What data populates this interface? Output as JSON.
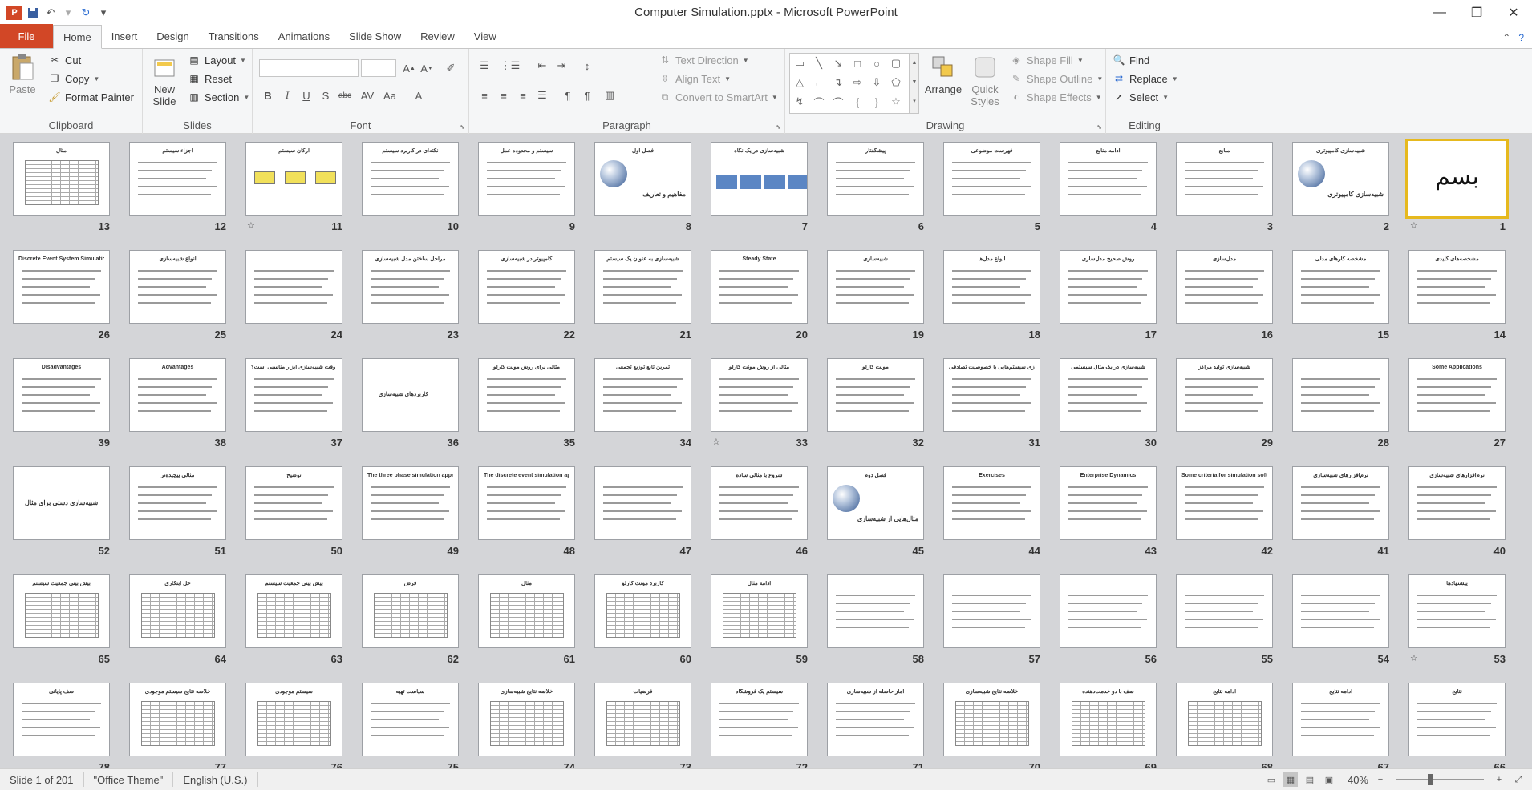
{
  "window": {
    "title": "Computer Simulation.pptx  -  Microsoft PowerPoint",
    "controls": [
      "minimize",
      "restore",
      "close"
    ]
  },
  "tabs": [
    "File",
    "Home",
    "Insert",
    "Design",
    "Transitions",
    "Animations",
    "Slide Show",
    "Review",
    "View"
  ],
  "active_tab": "Home",
  "ribbon": {
    "clipboard": {
      "label": "Clipboard",
      "paste": "Paste",
      "cut": "Cut",
      "copy": "Copy",
      "format_painter": "Format Painter"
    },
    "slides": {
      "label": "Slides",
      "new_slide_1": "New",
      "new_slide_2": "Slide",
      "layout": "Layout",
      "reset": "Reset",
      "section": "Section"
    },
    "font": {
      "label": "Font",
      "family": "",
      "size": ""
    },
    "paragraph": {
      "label": "Paragraph",
      "text_direction": "Text Direction",
      "align_text": "Align Text",
      "smartart": "Convert to SmartArt"
    },
    "drawing": {
      "label": "Drawing",
      "arrange": "Arrange",
      "quick_1": "Quick",
      "quick_2": "Styles",
      "shape_fill": "Shape Fill",
      "shape_outline": "Shape Outline",
      "shape_effects": "Shape Effects"
    },
    "editing": {
      "label": "Editing",
      "find": "Find",
      "replace": "Replace",
      "select": "Select"
    }
  },
  "slides": [
    {
      "n": "1",
      "t": ""
    },
    {
      "n": "2",
      "t": "شبیه‌سازی کامپیوتری"
    },
    {
      "n": "3",
      "t": "منابع"
    },
    {
      "n": "4",
      "t": "ادامه منابع"
    },
    {
      "n": "5",
      "t": "فهرست موضوعی"
    },
    {
      "n": "6",
      "t": "پیشگفتار"
    },
    {
      "n": "7",
      "t": "شبیه‌سازی در یک نگاه"
    },
    {
      "n": "8",
      "t": "فصل اول"
    },
    {
      "n": "9",
      "t": "سیستم و محدوده عمل"
    },
    {
      "n": "10",
      "t": "نکته‌ای در کاربرد سیستم"
    },
    {
      "n": "11",
      "t": "ارکان سیستم"
    },
    {
      "n": "12",
      "t": "اجزاء سیستم"
    },
    {
      "n": "13",
      "t": "مثال"
    },
    {
      "n": "14",
      "t": "مشخصه‌های کلیدی"
    },
    {
      "n": "15",
      "t": "مشخصه کارهای مدلی"
    },
    {
      "n": "16",
      "t": "مدل‌سازی"
    },
    {
      "n": "17",
      "t": "روش صحیح مدل‌سازی"
    },
    {
      "n": "18",
      "t": "انواع مدل‌ها"
    },
    {
      "n": "19",
      "t": "شبیه‌سازی"
    },
    {
      "n": "20",
      "t": "Steady State"
    },
    {
      "n": "21",
      "t": "شبیه‌سازی به عنوان یک سیستم"
    },
    {
      "n": "22",
      "t": "کامپیوتر در شبیه‌سازی"
    },
    {
      "n": "23",
      "t": "مراحل ساختن مدل شبیه‌سازی"
    },
    {
      "n": "24",
      "t": ""
    },
    {
      "n": "25",
      "t": "انواع شبیه‌سازی"
    },
    {
      "n": "26",
      "t": "Discrete Event System Simulation"
    },
    {
      "n": "27",
      "t": "Some Applications"
    },
    {
      "n": "28",
      "t": ""
    },
    {
      "n": "29",
      "t": "شبیه‌سازی تولید مراکز"
    },
    {
      "n": "30",
      "t": "شبیه‌سازی در یک مثال سیستمی"
    },
    {
      "n": "31",
      "t": "شبیه‌سازی سیستم‌هایی با خصوصیت تصادفی"
    },
    {
      "n": "32",
      "t": "مونت کارلو"
    },
    {
      "n": "33",
      "t": "مثالی از روش مونت کارلو"
    },
    {
      "n": "34",
      "t": "تمرین تابع توزیع تجمعی"
    },
    {
      "n": "35",
      "t": "مثالی برای روش مونت کارلو"
    },
    {
      "n": "36",
      "t": ""
    },
    {
      "n": "37",
      "t": "چه وقت شبیه‌سازی ابزار مناسبی است؟"
    },
    {
      "n": "38",
      "t": "Advantages"
    },
    {
      "n": "39",
      "t": "Disadvantages"
    },
    {
      "n": "40",
      "t": "نرم‌افزارهای شبیه‌سازی"
    },
    {
      "n": "41",
      "t": "نرم‌افزارهای شبیه‌سازی"
    },
    {
      "n": "42",
      "t": "Some criteria for simulation software"
    },
    {
      "n": "43",
      "t": "Enterprise Dynamics"
    },
    {
      "n": "44",
      "t": "Exercises"
    },
    {
      "n": "45",
      "t": "فصل دوم"
    },
    {
      "n": "46",
      "t": "شروع با مثالی ساده"
    },
    {
      "n": "47",
      "t": ""
    },
    {
      "n": "48",
      "t": "The discrete event simulation approach"
    },
    {
      "n": "49",
      "t": "The three phase simulation approach"
    },
    {
      "n": "50",
      "t": "توضیح"
    },
    {
      "n": "51",
      "t": "مثالی پیچیده‌تر"
    },
    {
      "n": "52",
      "t": ""
    },
    {
      "n": "53",
      "t": "پیشنهادها"
    },
    {
      "n": "54",
      "t": ""
    },
    {
      "n": "55",
      "t": ""
    },
    {
      "n": "56",
      "t": ""
    },
    {
      "n": "57",
      "t": ""
    },
    {
      "n": "58",
      "t": ""
    },
    {
      "n": "59",
      "t": "ادامه مثال"
    },
    {
      "n": "60",
      "t": "کاربرد مونت کارلو"
    },
    {
      "n": "61",
      "t": "مثال"
    },
    {
      "n": "62",
      "t": "فرض"
    },
    {
      "n": "63",
      "t": "بیش بینی جمعیت سیستم"
    },
    {
      "n": "64",
      "t": "حل ابتکاری"
    },
    {
      "n": "65",
      "t": "بیش بینی جمعیت سیستم"
    },
    {
      "n": "66",
      "t": "نتایج"
    },
    {
      "n": "67",
      "t": "ادامه نتایج"
    },
    {
      "n": "68",
      "t": "ادامه نتایج"
    },
    {
      "n": "69",
      "t": "صف با دو خدمت‌دهنده"
    },
    {
      "n": "70",
      "t": "خلاصه نتایج شبیه‌سازی"
    },
    {
      "n": "71",
      "t": "آمار حاصله از شبیه‌سازی"
    },
    {
      "n": "72",
      "t": "سیستم یک فروشگاه"
    },
    {
      "n": "73",
      "t": "فرضیات"
    },
    {
      "n": "74",
      "t": "خلاصه نتایج شبیه‌سازی"
    },
    {
      "n": "75",
      "t": "سیاست تهیه"
    },
    {
      "n": "76",
      "t": "سیستم موجودی"
    },
    {
      "n": "77",
      "t": "خلاصه نتایج سیستم موجودی"
    },
    {
      "n": "78",
      "t": "صف پایانی"
    }
  ],
  "slide_2_subtitle": "شبیه‌سازی کامپیوتری",
  "slide_8_subtitle": "مفاهیم و تعاریف",
  "slide_45_subtitle": "مثال‌هایی از شبیه‌سازی",
  "slide_52_text": "شبیه‌سازی دستی برای مثال",
  "slide_36_text": "کاربردهای شبیه‌سازی",
  "status": {
    "slide": "Slide 1 of 201",
    "theme": "\"Office Theme\"",
    "language": "English (U.S.)",
    "zoom": "40%"
  }
}
